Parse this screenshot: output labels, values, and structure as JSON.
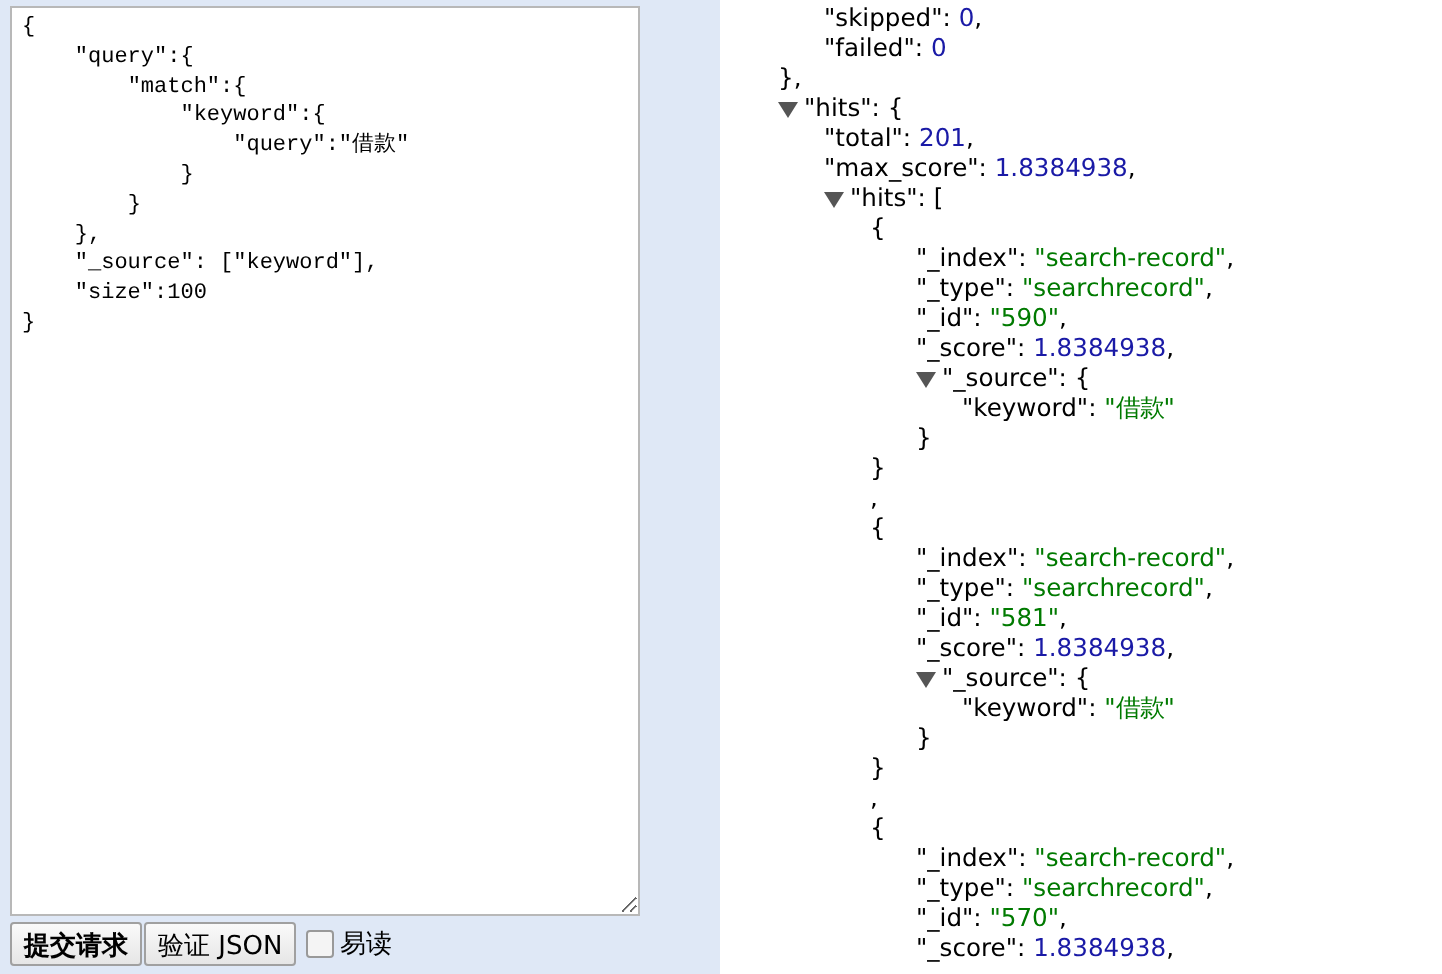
{
  "editor": {
    "query_text": "{\n    \"query\":{\n        \"match\":{\n            \"keyword\":{\n                \"query\":\"借款\"\n            }\n        }\n    },\n    \"_source\": [\"keyword\"],\n    \"size\":100\n}",
    "buttons": [
      {
        "label": "提交请求",
        "kind": "primary"
      },
      {
        "label": "验证 JSON",
        "kind": "normal"
      }
    ],
    "readable": {
      "label": "易读",
      "checked": false
    }
  },
  "viewer": {
    "items": [
      {
        "kind": "fragment",
        "children": [
          {
            "kind": "number",
            "key": "\"skipped\":",
            "value": "0",
            "tail": ","
          },
          {
            "kind": "number",
            "key": "\"failed\":",
            "value": "0"
          }
        ],
        "close": "},"
      },
      {
        "kind": "object",
        "key": "\"hits\":",
        "open": "{",
        "expanded": true,
        "children": [
          {
            "kind": "number",
            "key": "\"total\":",
            "value": "201",
            "tail": ","
          },
          {
            "kind": "number",
            "key": "\"max_score\":",
            "value": "1.8384938",
            "tail": ","
          },
          {
            "kind": "array",
            "key": "\"hits\":",
            "open": "[",
            "expanded": true,
            "children": [
              {
                "kind": "element",
                "open": "{",
                "children": [
                  {
                    "kind": "string",
                    "key": "\"_index\":",
                    "value": "\"search-record\"",
                    "tail": ","
                  },
                  {
                    "kind": "string",
                    "key": "\"_type\":",
                    "value": "\"searchrecord\"",
                    "tail": ","
                  },
                  {
                    "kind": "string",
                    "key": "\"_id\":",
                    "value": "\"590\"",
                    "tail": ","
                  },
                  {
                    "kind": "number",
                    "key": "\"_score\":",
                    "value": "1.8384938",
                    "tail": ","
                  },
                  {
                    "kind": "object",
                    "key": "\"_source\":",
                    "open": "{",
                    "expanded": true,
                    "children": [
                      {
                        "kind": "string",
                        "key": "\"keyword\":",
                        "value": "\"借款\""
                      }
                    ],
                    "close": "}"
                  }
                ],
                "close": "}"
              },
              {
                "kind": "separator",
                "text": ","
              },
              {
                "kind": "element",
                "open": "{",
                "children": [
                  {
                    "kind": "string",
                    "key": "\"_index\":",
                    "value": "\"search-record\"",
                    "tail": ","
                  },
                  {
                    "kind": "string",
                    "key": "\"_type\":",
                    "value": "\"searchrecord\"",
                    "tail": ","
                  },
                  {
                    "kind": "string",
                    "key": "\"_id\":",
                    "value": "\"581\"",
                    "tail": ","
                  },
                  {
                    "kind": "number",
                    "key": "\"_score\":",
                    "value": "1.8384938",
                    "tail": ","
                  },
                  {
                    "kind": "object",
                    "key": "\"_source\":",
                    "open": "{",
                    "expanded": true,
                    "children": [
                      {
                        "kind": "string",
                        "key": "\"keyword\":",
                        "value": "\"借款\""
                      }
                    ],
                    "close": "}"
                  }
                ],
                "close": "}"
              },
              {
                "kind": "separator",
                "text": ","
              },
              {
                "kind": "element",
                "open": "{",
                "children": [
                  {
                    "kind": "string",
                    "key": "\"_index\":",
                    "value": "\"search-record\"",
                    "tail": ","
                  },
                  {
                    "kind": "string",
                    "key": "\"_type\":",
                    "value": "\"searchrecord\"",
                    "tail": ","
                  },
                  {
                    "kind": "string",
                    "key": "\"_id\":",
                    "value": "\"570\"",
                    "tail": ","
                  },
                  {
                    "kind": "number",
                    "key": "\"_score\":",
                    "value": "1.8384938",
                    "tail": ","
                  }
                ]
              }
            ]
          }
        ]
      }
    ]
  }
}
